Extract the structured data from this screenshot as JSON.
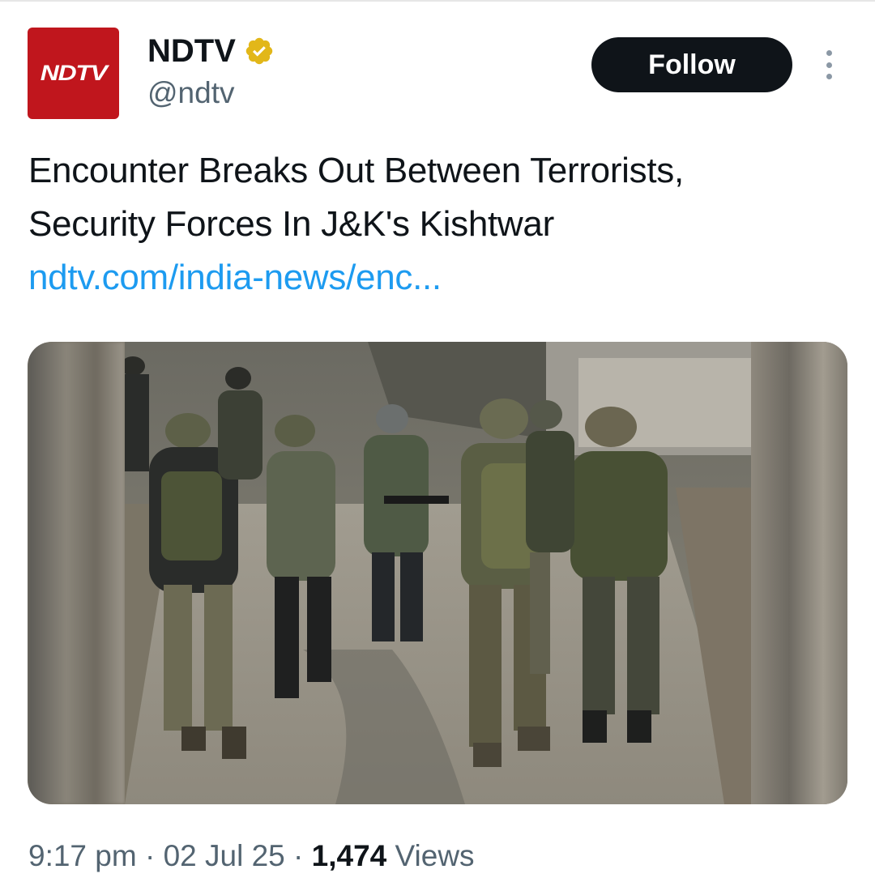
{
  "author": {
    "avatar_text": "NDTV",
    "display_name": "NDTV",
    "handle": "@ndtv",
    "verified_badge_color": "#e2b719",
    "avatar_color": "#c0161d"
  },
  "actions": {
    "follow_label": "Follow",
    "more_icon": "more-vertical-icon"
  },
  "tweet": {
    "line1": "Encounter Breaks Out Between Terrorists,",
    "line2": "Security Forces In J&K's Kishtwar",
    "link": "ndtv.com/india-news/enc..."
  },
  "media": {
    "description_icon": "photo"
  },
  "meta": {
    "time": "9:17 pm",
    "sep1": " · ",
    "date": "02 Jul 25",
    "sep2": " · ",
    "views_count": "1,474",
    "views_label": " Views"
  },
  "colors": {
    "link": "#1d9bf0",
    "secondary_text": "#536471",
    "primary_text": "#0f1419",
    "follow_bg": "#0f1419"
  }
}
